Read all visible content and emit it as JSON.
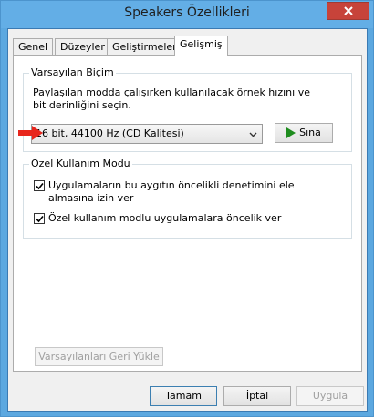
{
  "window": {
    "title": "Speakers Özellikleri"
  },
  "tabs": [
    {
      "label": "Genel",
      "active": false
    },
    {
      "label": "Düzeyler",
      "active": false
    },
    {
      "label": "Geliştirmeler",
      "active": false
    },
    {
      "label": "Gelişmiş",
      "active": true
    }
  ],
  "default_format": {
    "group_title": "Varsayılan Biçim",
    "description": "Paylaşılan modda çalışırken kullanılacak örnek hızını ve bit derinliğini seçin.",
    "selected_format": "16 bit, 44100 Hz (CD Kalitesi)",
    "test_label": "Sına"
  },
  "exclusive_mode": {
    "group_title": "Özel Kullanım Modu",
    "options": [
      {
        "label": "Uygulamaların bu aygıtın öncelikli denetimini ele almasına izin ver",
        "checked": true
      },
      {
        "label": "Özel kullanım modlu uygulamalara öncelik ver",
        "checked": true
      }
    ]
  },
  "restore_defaults_label": "Varsayılanları Geri Yükle",
  "buttons": {
    "ok": "Tamam",
    "cancel": "İptal",
    "apply": "Uygula"
  },
  "colors": {
    "titlebar": "#63aee6",
    "close": "#c7433a",
    "annotation_arrow": "#e8261c",
    "play": "#1e8c1e"
  }
}
